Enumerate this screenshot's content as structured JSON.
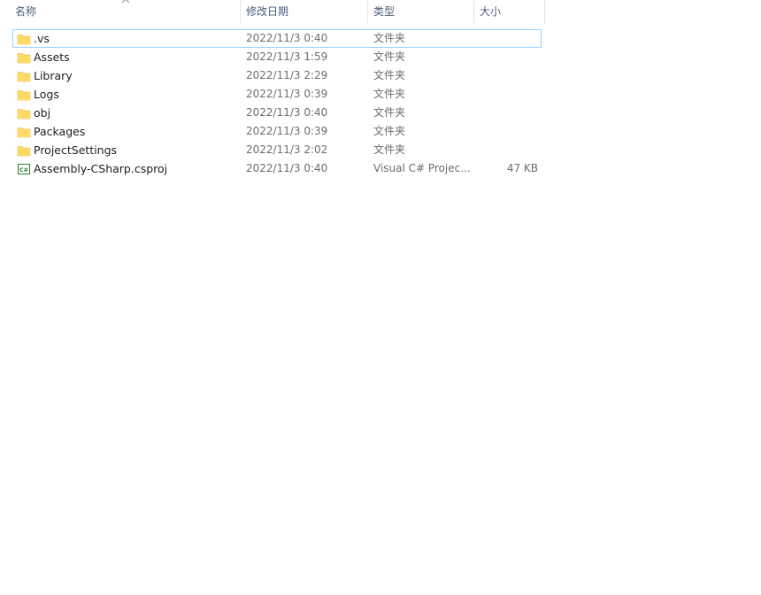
{
  "columns": {
    "name": "名称",
    "date": "修改日期",
    "type": "类型",
    "size": "大小"
  },
  "sort": {
    "column": "name",
    "direction": "ascending",
    "icon": "chevron-up-icon"
  },
  "files": [
    {
      "name": ".vs",
      "date": "2022/11/3 0:40",
      "type": "文件夹",
      "size": "",
      "icon": "folder-icon",
      "selected": true
    },
    {
      "name": "Assets",
      "date": "2022/11/3 1:59",
      "type": "文件夹",
      "size": "",
      "icon": "folder-icon"
    },
    {
      "name": "Library",
      "date": "2022/11/3 2:29",
      "type": "文件夹",
      "size": "",
      "icon": "folder-icon"
    },
    {
      "name": "Logs",
      "date": "2022/11/3 0:39",
      "type": "文件夹",
      "size": "",
      "icon": "folder-icon"
    },
    {
      "name": "obj",
      "date": "2022/11/3 0:40",
      "type": "文件夹",
      "size": "",
      "icon": "folder-icon"
    },
    {
      "name": "Packages",
      "date": "2022/11/3 0:39",
      "type": "文件夹",
      "size": "",
      "icon": "folder-icon"
    },
    {
      "name": "ProjectSettings",
      "date": "2022/11/3 2:02",
      "type": "文件夹",
      "size": "",
      "icon": "folder-icon"
    },
    {
      "name": "Assembly-CSharp.csproj",
      "date": "2022/11/3 0:40",
      "type": "Visual C# Projec...",
      "size": "47 KB",
      "icon": "csharp-project-icon"
    }
  ],
  "colors": {
    "folder": "#ffd866",
    "selection_border": "#99d1ff",
    "header_text": "#4c607a",
    "secondary_text": "#6d6d6d"
  }
}
